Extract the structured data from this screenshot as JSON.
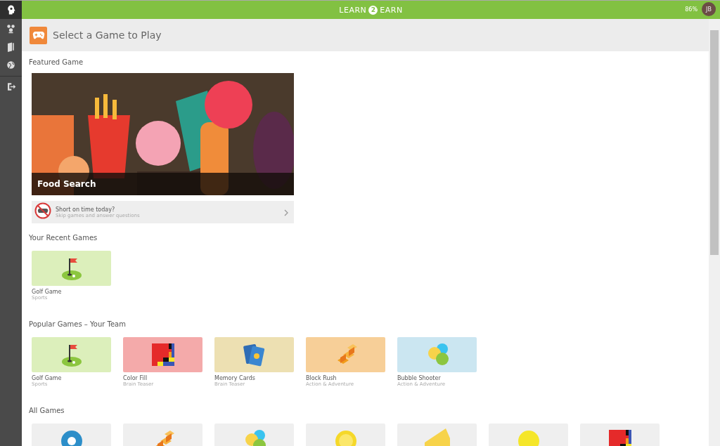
{
  "top_bar": {
    "brand_left": "LEARN",
    "brand_badge": "2",
    "brand_right": "EARN",
    "percent": "86%",
    "avatar": "JB"
  },
  "sidebar": {
    "items": [
      {
        "kind": "people",
        "selected": false
      },
      {
        "kind": "book",
        "selected": false
      },
      {
        "kind": "globe",
        "selected": false
      },
      {
        "kind": "logout",
        "selected": false
      }
    ]
  },
  "header": {
    "title": "Select a Game to Play"
  },
  "featured": {
    "heading": "Featured Game",
    "title": "Food Search"
  },
  "skip_banner": {
    "title": "Short on time today?",
    "subtitle": "Skip games and answer questions"
  },
  "sections": [
    {
      "heading": "Your Recent Games",
      "games": [
        {
          "name": "Golf Game",
          "category": "Sports",
          "kind": "golf",
          "color": "#dcefbb"
        }
      ]
    },
    {
      "heading": "Popular Games – Your Team",
      "games": [
        {
          "name": "Golf Game",
          "category": "Sports",
          "kind": "golf",
          "color": "#dcefbb"
        },
        {
          "name": "Color Fill",
          "category": "Brain Teaser",
          "kind": "colorfill",
          "color": "#f4aaaa"
        },
        {
          "name": "Memory Cards",
          "category": "Brain Teaser",
          "kind": "cards",
          "color": "#ede0b2"
        },
        {
          "name": "Block Rush",
          "category": "Action & Adventure",
          "kind": "blocks",
          "color": "#f7cf98"
        },
        {
          "name": "Bubble Shooter",
          "category": "Action & Adventure",
          "kind": "bubbles",
          "color": "#cbe6f1"
        }
      ]
    },
    {
      "heading": "All Games",
      "games": [
        {
          "kind": "ball",
          "color": "#efefef"
        },
        {
          "kind": "blocks",
          "color": "#efefef"
        },
        {
          "kind": "bubbles",
          "color": "#efefef"
        },
        {
          "kind": "coin",
          "color": "#efefef"
        },
        {
          "kind": "cheese",
          "color": "#efefef"
        },
        {
          "kind": "sun",
          "color": "#efefef"
        },
        {
          "kind": "colorfill",
          "color": "#efefef"
        }
      ]
    }
  ]
}
